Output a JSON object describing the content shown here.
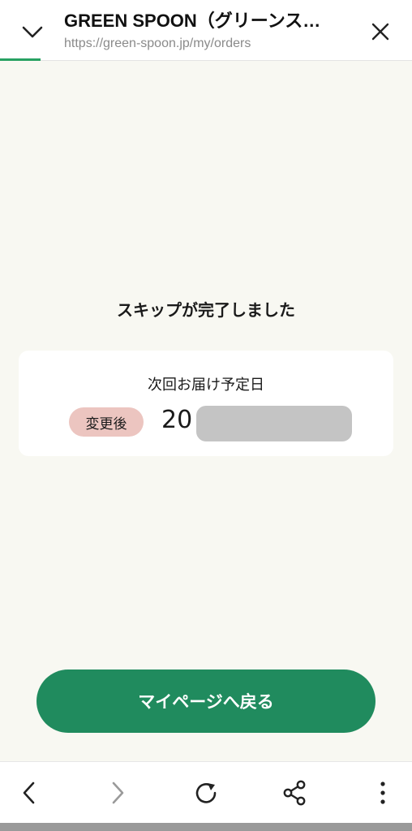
{
  "browser": {
    "title": "GREEN SPOON（グリーンス…",
    "url": "https://green-spoon.jp/my/orders"
  },
  "main": {
    "message": "スキップが完了しました",
    "next_delivery_label": "次回お届け予定日",
    "badge": "変更後",
    "date_visible": "20",
    "button_label": "マイページへ戻る"
  },
  "colors": {
    "accent": "#208b5e",
    "badge_bg": "#ecc5c0",
    "page_bg": "#f8f8f2"
  },
  "icons": {
    "collapse": "chevron-down-icon",
    "close": "close-icon",
    "back": "chevron-left-icon",
    "forward": "chevron-right-icon",
    "reload": "reload-icon",
    "share": "share-icon",
    "menu": "more-vertical-icon"
  }
}
